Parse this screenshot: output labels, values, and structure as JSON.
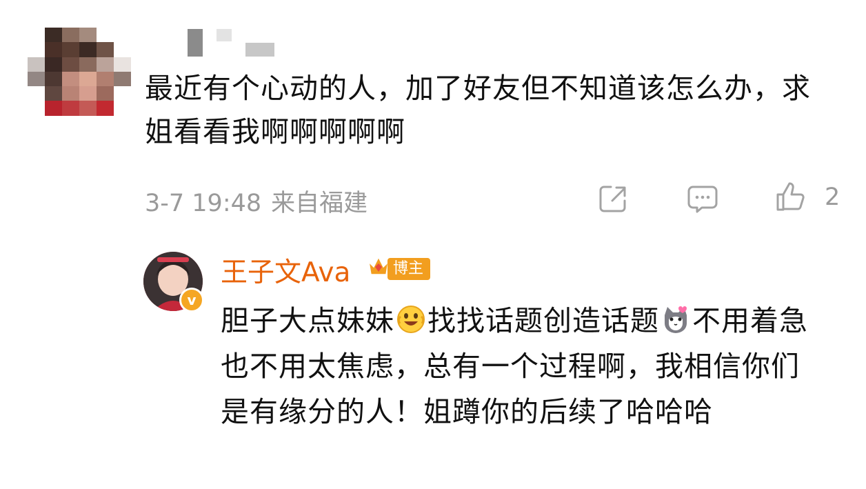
{
  "comment": {
    "text": "最近有个心动的人，加了好友但不知道该怎么办，求姐看看我啊啊啊啊啊",
    "time": "3-7 19:48",
    "location": "来自福建",
    "like_count": "2"
  },
  "reply": {
    "author": "王子文Ava",
    "badge": "博主",
    "text_part1": "胆子大点妹妹",
    "text_part2": "找找话题创造话题",
    "text_part3": "不用着急也不用太焦虑，总有一个过程啊，我相信你们是有缘分的人！姐蹲你的后续了哈哈哈",
    "verified_mark": "v"
  },
  "icons": {
    "share": "share-icon",
    "comment": "comment-icon",
    "like": "thumbs-up-icon",
    "emoji1": "grinning-emoji-icon",
    "emoji2": "cat-emoji-icon",
    "crown": "crown-icon"
  },
  "colors": {
    "author_name": "#e8630a",
    "badge_bg": "#f29e1f",
    "meta_text": "#9a9a9a"
  }
}
